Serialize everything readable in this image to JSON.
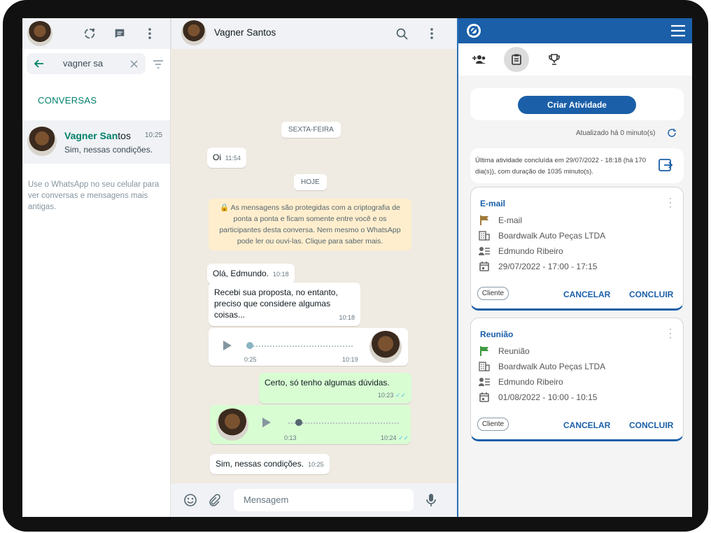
{
  "left": {
    "search_value": "vagner sa",
    "section_label": "CONVERSAS",
    "chat": {
      "name_bold": "Vagner San",
      "name_rest": "tos",
      "time": "10:25",
      "preview": "Sim, nessas condições."
    },
    "note": "Use o WhatsApp no seu celular para ver conversas e mensagens mais antigas."
  },
  "chat": {
    "contact_name": "Vagner Santos",
    "day1": "SEXTA-FEIRA",
    "day2": "HOJE",
    "msg_oi": "Oi",
    "msg_oi_time": "11:54",
    "encryption": "🔒 As mensagens são protegidas com a criptografia de ponta a ponta e ficam somente entre você e os participantes desta conversa. Nem mesmo o WhatsApp pode ler ou ouvi-las. Clique para saber mais.",
    "msg_ola": "Olá, Edmundo.",
    "msg_ola_time": "10:18",
    "msg_proposta": "Recebi sua proposta, no entanto, preciso que considere algumas coisas...",
    "msg_proposta_time": "10:18",
    "audio1_duration": "0:25",
    "audio1_time": "10:19",
    "msg_duvidas": "Certo, só tenho algumas dúvidas.",
    "msg_duvidas_time": "10:23",
    "audio2_duration": "0:13",
    "audio2_time": "10:24",
    "msg_sim": "Sim, nessas condições.",
    "msg_sim_time": "10:25",
    "input_placeholder": "Mensagem"
  },
  "crm": {
    "create_button": "Criar Atividade",
    "updated": "Atualizado há 0 minuto(s)",
    "last_activity": "Última atividade concluída em 29/07/2022 - 18:18 (há 170 dia(s)), com duração de 1035 minuto(s).",
    "activities": [
      {
        "title": "E-mail",
        "type": "E-mail",
        "company": "Boardwalk Auto Peças LTDA",
        "contact": "Edmundo Ribeiro",
        "date": "29/07/2022 - 17:00 - 17:15",
        "chip": "Cliente",
        "cancel": "CANCELAR",
        "confirm": "CONCLUIR",
        "flag_color": "#a07a3c"
      },
      {
        "title": "Reunião",
        "type": "Reunião",
        "company": "Boardwalk Auto Peças LTDA",
        "contact": "Edmundo Ribeiro",
        "date": "01/08/2022 - 10:00 - 10:15",
        "chip": "Cliente",
        "cancel": "CANCELAR",
        "confirm": "CONCLUIR",
        "flag_color": "#3f9a3f"
      }
    ]
  },
  "colors": {
    "whatsapp_green": "#008069",
    "crm_blue": "#1a5fa8",
    "outgoing_bubble": "#d9fdd3",
    "chat_bg": "#efeae2"
  }
}
